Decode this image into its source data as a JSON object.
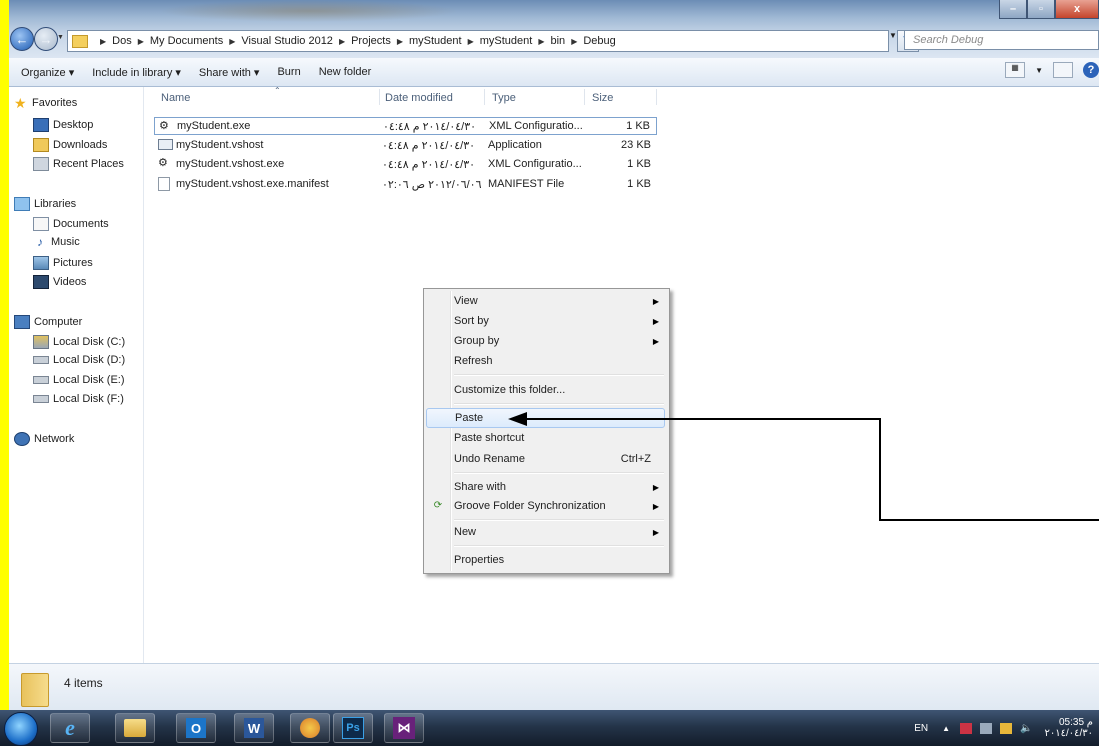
{
  "window": {
    "minimize": "–",
    "maximize": "▫",
    "close": "x"
  },
  "address": {
    "crumbs": [
      "Dos",
      "My Documents",
      "Visual Studio 2012",
      "Projects",
      "myStudent",
      "myStudent",
      "bin",
      "Debug"
    ],
    "search_placeholder": "Search Debug"
  },
  "toolbar": {
    "organize": "Organize ▾",
    "include": "Include in library ▾",
    "share": "Share with ▾",
    "burn": "Burn",
    "new_folder": "New folder"
  },
  "sidebar": {
    "favorites": "Favorites",
    "fav_items": [
      "Desktop",
      "Downloads",
      "Recent Places"
    ],
    "libraries": "Libraries",
    "lib_items": [
      "Documents",
      "Music",
      "Pictures",
      "Videos"
    ],
    "computer": "Computer",
    "comp_items": [
      "Local Disk (C:)",
      "Local Disk (D:)",
      "Local Disk (E:)",
      "Local Disk (F:)"
    ],
    "network": "Network"
  },
  "columns": {
    "name": "Name",
    "date": "Date modified",
    "type": "Type",
    "size": "Size"
  },
  "files": [
    {
      "name": "myStudent.exe",
      "date": "٢٠١٤/٠٤/٣٠ م ٠٤:٤٨",
      "type": "XML Configuratio...",
      "size": "1 KB"
    },
    {
      "name": "myStudent.vshost",
      "date": "٢٠١٤/٠٤/٣٠ م ٠٤:٤٨",
      "type": "Application",
      "size": "23 KB"
    },
    {
      "name": "myStudent.vshost.exe",
      "date": "٢٠١٤/٠٤/٣٠ م ٠٤:٤٨",
      "type": "XML Configuratio...",
      "size": "1 KB"
    },
    {
      "name": "myStudent.vshost.exe.manifest",
      "date": "٢٠١٢/٠٦/٠٦ ص ٠٢:٠٦",
      "type": "MANIFEST File",
      "size": "1 KB"
    }
  ],
  "status": {
    "count": "4 items"
  },
  "context_menu": {
    "view": "View",
    "sort_by": "Sort by",
    "group_by": "Group by",
    "refresh": "Refresh",
    "customize": "Customize this folder...",
    "paste": "Paste",
    "paste_shortcut": "Paste shortcut",
    "undo_rename": "Undo Rename",
    "undo_shortcut": "Ctrl+Z",
    "share_with": "Share with",
    "groove": "Groove Folder Synchronization",
    "new": "New",
    "properties": "Properties"
  },
  "taskbar": {
    "ps": "Ps",
    "lang": "EN",
    "time": "05:35 م",
    "date": "٢٠١٤/٠٤/٣٠"
  },
  "colors": {
    "border_yellow": "#ffff00",
    "selection_border": "#7da2ce",
    "menu_hot": "#dcebfc",
    "annotation_arrow": "#000000"
  }
}
